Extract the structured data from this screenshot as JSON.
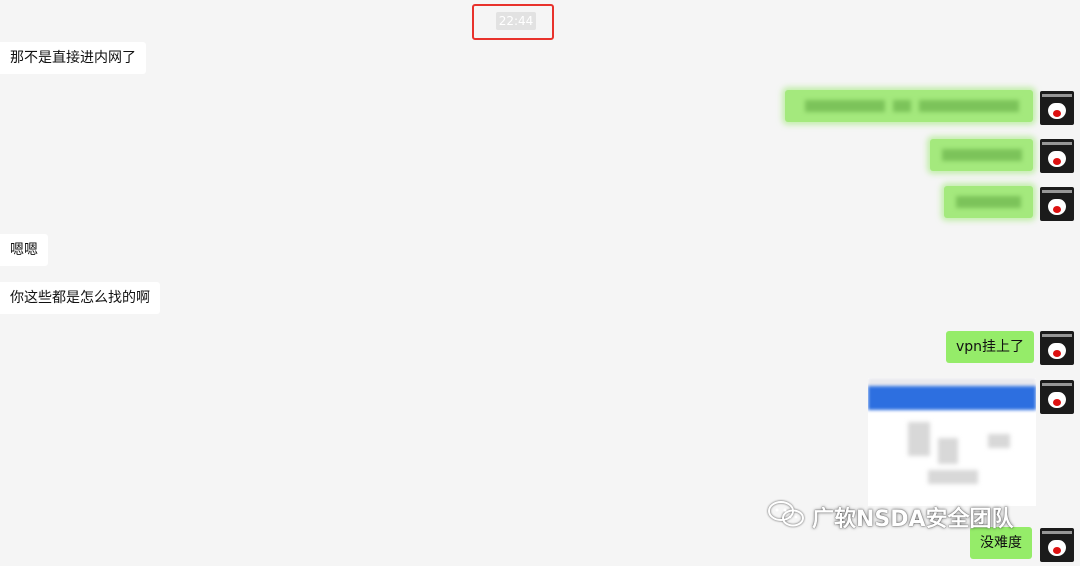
{
  "chat": {
    "timestamp": "22:44",
    "messages": [
      {
        "side": "left",
        "text": "那不是直接进内网了"
      },
      {
        "side": "right",
        "redacted": true
      },
      {
        "side": "right",
        "redacted": true
      },
      {
        "side": "right",
        "redacted": true
      },
      {
        "side": "left",
        "text": "嗯嗯"
      },
      {
        "side": "left",
        "text": "你这些都是怎么找的啊"
      },
      {
        "side": "right",
        "text": "vpn挂上了"
      },
      {
        "side": "right",
        "image": true
      },
      {
        "side": "right",
        "text": "没难度"
      }
    ]
  },
  "watermark": {
    "text": "广软NSDA安全团队",
    "icon": "wechat-icon"
  },
  "colors": {
    "background": "#f5f5f5",
    "sent_bubble": "#95ec69",
    "received_bubble": "#ffffff",
    "highlight": "#e8322c"
  }
}
